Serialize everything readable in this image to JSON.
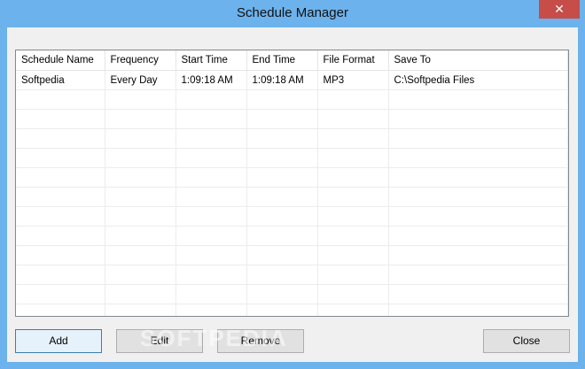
{
  "window": {
    "title": "Schedule Manager",
    "close_glyph": "✕"
  },
  "table": {
    "columns": [
      "Schedule Name",
      "Frequency",
      "Start Time",
      "End Time",
      "File Format",
      "Save To"
    ],
    "rows": [
      [
        "Softpedia",
        "Every Day",
        "1:09:18 AM",
        "1:09:18 AM",
        "MP3",
        "C:\\Softpedia Files"
      ]
    ]
  },
  "buttons": {
    "add": "Add",
    "edit": "Edit",
    "remove": "Remove",
    "close": "Close"
  },
  "watermark": "SOFTPEDIA"
}
